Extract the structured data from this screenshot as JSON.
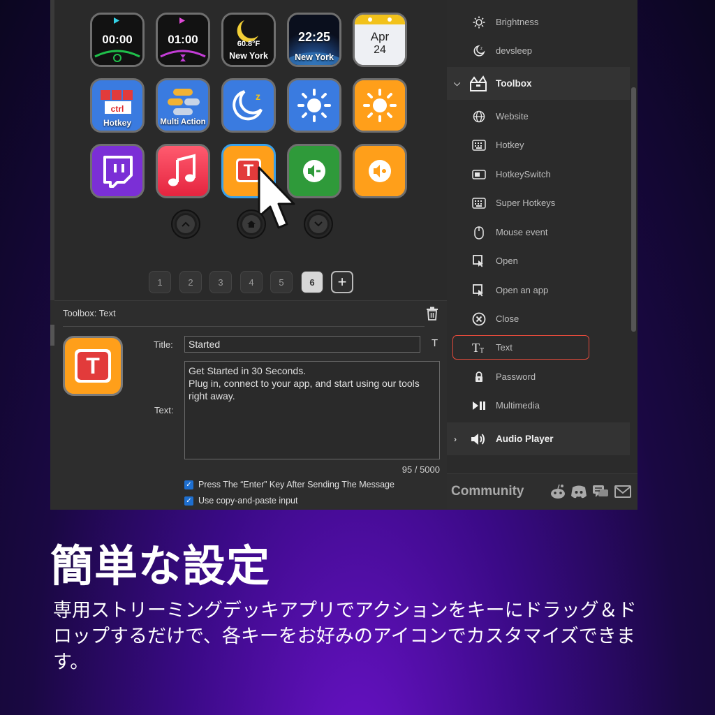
{
  "deck": {
    "keys": [
      {
        "name": "timer-key",
        "label": "00:00"
      },
      {
        "name": "countdown-key",
        "label": "01:00"
      },
      {
        "name": "weather-key",
        "temp": "60.8°F",
        "city": "New York"
      },
      {
        "name": "clock-key",
        "time": "22:25",
        "city": "New York"
      },
      {
        "name": "date-key",
        "month": "Apr",
        "day": "24"
      },
      {
        "name": "hotkey-key",
        "label": "Hotkey",
        "badge": "ctrl"
      },
      {
        "name": "multi-action-key",
        "label": "Multi Action"
      },
      {
        "name": "sleep-key",
        "label": ""
      },
      {
        "name": "brightness-down-key",
        "label": ""
      },
      {
        "name": "brightness-up-key",
        "label": ""
      },
      {
        "name": "twitch-key",
        "label": ""
      },
      {
        "name": "music-key",
        "label": ""
      },
      {
        "name": "text-key",
        "label": "T"
      },
      {
        "name": "volume-down-key",
        "label": ""
      },
      {
        "name": "volume-up-key",
        "label": ""
      }
    ],
    "pages": [
      "1",
      "2",
      "3",
      "4",
      "5",
      "6"
    ],
    "active_page": "6",
    "add_page": "+"
  },
  "editor": {
    "heading": "Toolbox: Text",
    "title_label": "Title:",
    "title_value": "Started",
    "text_label": "Text:",
    "text_value": "Get Started in 30 Seconds.\nPlug in, connect to your app, and start using our tools right away.",
    "char_count": "95 / 5000",
    "toggle": "T",
    "icon_letter": "T",
    "options": [
      {
        "label": "Press The “Enter” Key After Sending The Message",
        "checked": true
      },
      {
        "label": "Use copy-and-paste input",
        "checked": true
      }
    ]
  },
  "toolbox": {
    "top_items": [
      {
        "label": "Brightness",
        "icon": "sun-icon"
      },
      {
        "label": "devsleep",
        "icon": "moon-icon"
      }
    ],
    "category": {
      "label": "Toolbox",
      "icon": "toolbox-icon"
    },
    "items": [
      {
        "label": "Website",
        "icon": "globe-icon"
      },
      {
        "label": "Hotkey",
        "icon": "keyboard-icon"
      },
      {
        "label": "HotkeySwitch",
        "icon": "switch-icon"
      },
      {
        "label": "Super Hotkeys",
        "icon": "keyboard-icon"
      },
      {
        "label": "Mouse event",
        "icon": "mouse-icon"
      },
      {
        "label": "Open",
        "icon": "open-icon"
      },
      {
        "label": "Open an app",
        "icon": "open-app-icon"
      },
      {
        "label": "Close",
        "icon": "close-icon"
      },
      {
        "label": "Text",
        "icon": "text-icon"
      },
      {
        "label": "Password",
        "icon": "lock-icon"
      },
      {
        "label": "Multimedia",
        "icon": "play-pause-icon"
      }
    ],
    "selected": "Text",
    "next_category": {
      "label": "Audio Player",
      "icon": "speaker-icon"
    },
    "community": "Community"
  },
  "caption": {
    "headline": "簡単な設定",
    "description": "専用ストリーミングデッキアプリでアクションをキーにドラッグ＆ドロップするだけで、各キーをお好みのアイコンでカスタマイズできます。"
  },
  "colors": {
    "accent_orange": "#ff9f1a",
    "selection_red": "#e24a3b",
    "checkbox_blue": "#1e6fd0",
    "background_purple": "#3a0a86"
  }
}
